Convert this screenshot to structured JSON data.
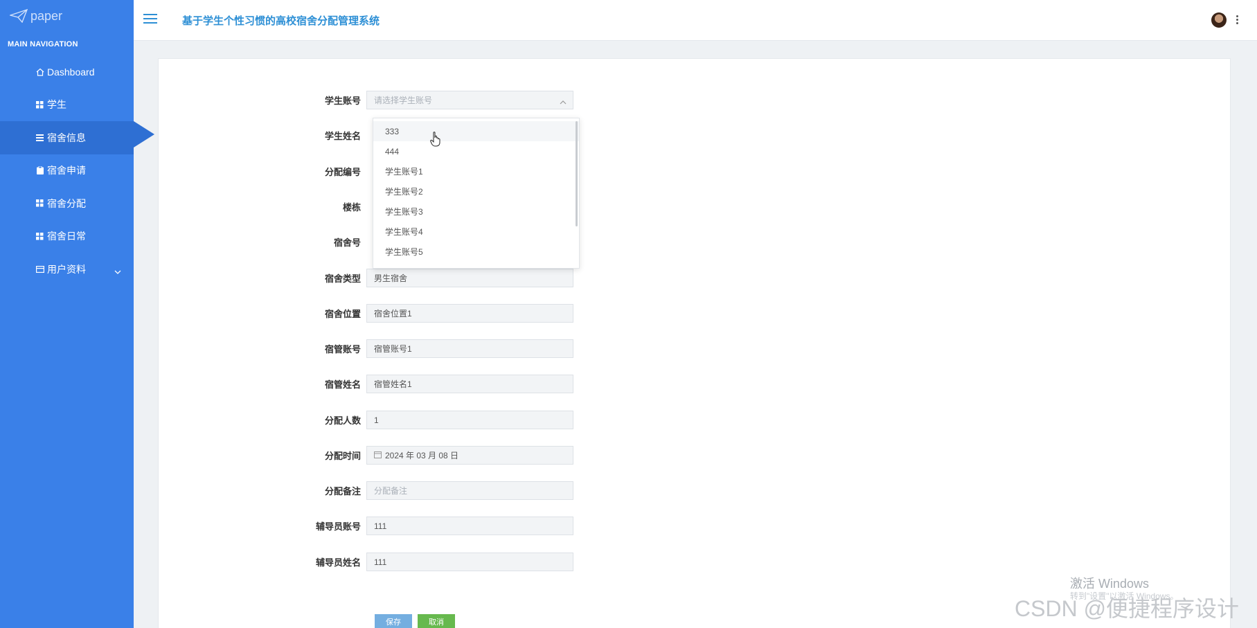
{
  "app": {
    "logo_text": "paper",
    "title": "基于学生个性习惯的高校宿舍分配管理系统"
  },
  "sidebar": {
    "header": "MAIN NAVIGATION",
    "items": [
      {
        "label": "Dashboard",
        "icon": "home-icon"
      },
      {
        "label": "学生",
        "icon": "grid-icon"
      },
      {
        "label": "宿舍信息",
        "icon": "list-icon",
        "active": true
      },
      {
        "label": "宿舍申请",
        "icon": "clipboard-icon"
      },
      {
        "label": "宿舍分配",
        "icon": "grid-icon"
      },
      {
        "label": "宿舍日常",
        "icon": "grid-icon"
      },
      {
        "label": "用户资料",
        "icon": "card-icon",
        "expandable": true
      }
    ]
  },
  "form": {
    "student_account": {
      "label": "学生账号",
      "placeholder": "请选择学生账号"
    },
    "student_name": {
      "label": "学生姓名"
    },
    "assign_no": {
      "label": "分配编号"
    },
    "building": {
      "label": "楼栋"
    },
    "dorm_no": {
      "label": "宿舍号"
    },
    "dorm_type": {
      "label": "宿舍类型",
      "value": "男生宿舍"
    },
    "dorm_location": {
      "label": "宿舍位置",
      "value": "宿舍位置1"
    },
    "manager_account": {
      "label": "宿管账号",
      "value": "宿管账号1"
    },
    "manager_name": {
      "label": "宿管姓名",
      "value": "宿管姓名1"
    },
    "assign_count": {
      "label": "分配人数",
      "value": "1"
    },
    "assign_time": {
      "label": "分配时间",
      "value": "2024 年 03 月 08 日"
    },
    "assign_note": {
      "label": "分配备注",
      "placeholder": "分配备注"
    },
    "counselor_account": {
      "label": "辅导员账号",
      "value": "111"
    },
    "counselor_name": {
      "label": "辅导员姓名",
      "value": "111"
    },
    "save_label": "保存",
    "cancel_label": "取消"
  },
  "dropdown": {
    "options": [
      "333",
      "444",
      "学生账号1",
      "学生账号2",
      "学生账号3",
      "学生账号4",
      "学生账号5"
    ],
    "hovered": "333"
  },
  "overlay": {
    "activate_windows": "激活 Windows",
    "activate_hint": "转到\"设置\"以激活 Windows。",
    "csdn_watermark": "CSDN @便捷程序设计"
  },
  "colors": {
    "sidebar": "#3a80e8",
    "sidebar_active": "#2e6fd3",
    "title": "#2d8fd5",
    "save": "#74aee0",
    "cancel": "#67b94e"
  }
}
